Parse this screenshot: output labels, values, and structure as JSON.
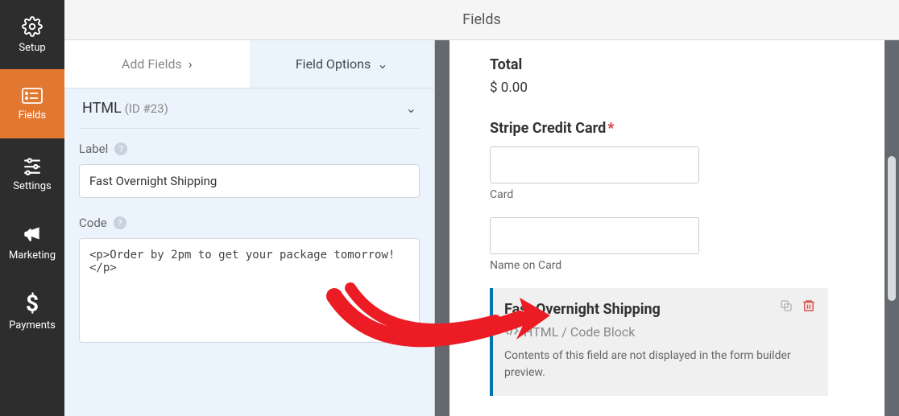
{
  "sidebar": {
    "items": [
      {
        "label": "Setup"
      },
      {
        "label": "Fields"
      },
      {
        "label": "Settings"
      },
      {
        "label": "Marketing"
      },
      {
        "label": "Payments"
      }
    ]
  },
  "header": {
    "title": "Fields"
  },
  "tabs": {
    "add": "Add Fields",
    "options": "Field Options"
  },
  "fieldBar": {
    "name": "HTML",
    "id": "(ID #23)"
  },
  "form": {
    "labelTitle": "Label",
    "labelValue": "Fast Overnight Shipping",
    "codeTitle": "Code",
    "codeValue": "<p>Order by 2pm to get your package tomorrow!</p>"
  },
  "preview": {
    "totalLabel": "Total",
    "totalValue": "$ 0.00",
    "stripeLabel": "Stripe Credit Card",
    "cardSub": "Card",
    "nameSub": "Name on Card",
    "cardTitle": "Fast Overnight Shipping",
    "cardSub2": "HTML / Code Block",
    "cardDesc": "Contents of this field are not displayed in the form builder preview."
  }
}
